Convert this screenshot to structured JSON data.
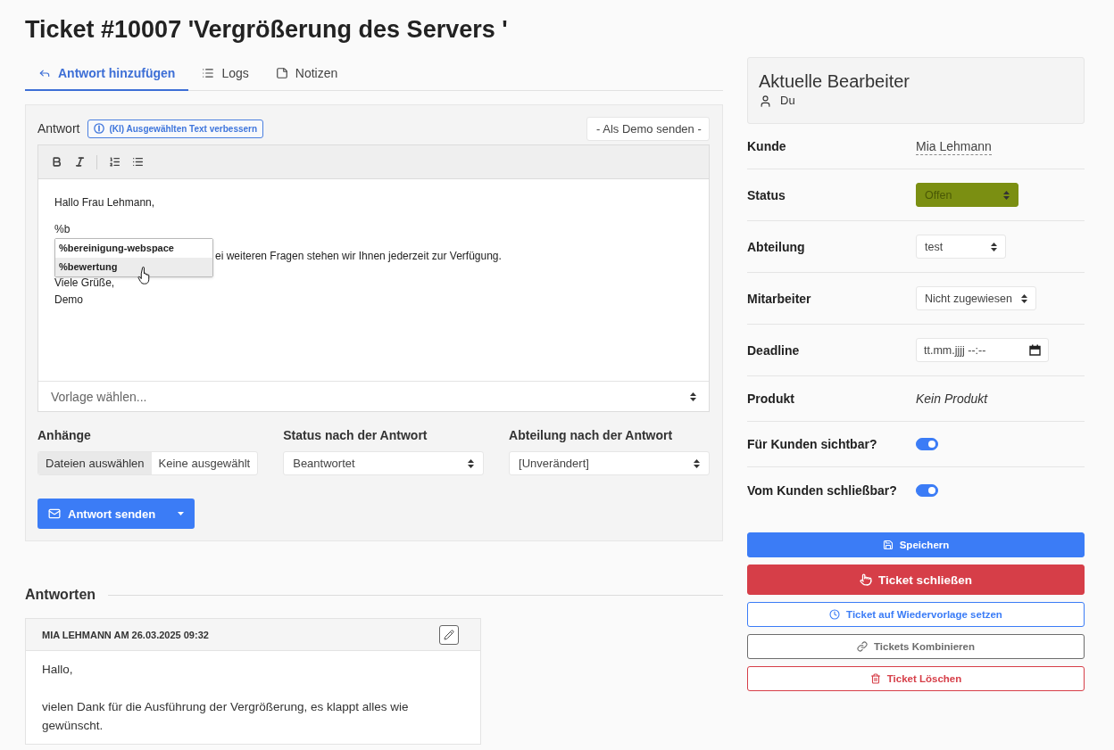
{
  "title": "Ticket #10007 'Vergrößerung des Servers '",
  "tabs": [
    {
      "label": "Antwort hinzufügen",
      "selected": true
    },
    {
      "label": "Logs",
      "selected": false
    },
    {
      "label": "Notizen",
      "selected": false
    }
  ],
  "reply_form": {
    "label": "Antwort",
    "ai_button": "(KI) Ausgewählten Text verbessern",
    "send_as_select": "- Als Demo senden -",
    "editor": {
      "paragraphs": [
        {
          "lines": [
            "Hallo Frau Lehmann,"
          ]
        },
        {
          "lines": [
            "%b"
          ],
          "suggestions": [
            {
              "label": "%bereinigung-webspace",
              "selected": false
            },
            {
              "label": "%bewertung",
              "selected": true
            }
          ]
        },
        {
          "lines": [
            "ei weiteren Fragen stehen wir Ihnen jederzeit zur Verfügung."
          ]
        },
        {
          "lines": [
            "Viele Grüße,",
            "Demo"
          ]
        }
      ],
      "template_select": "Vorlage wählen..."
    },
    "attachments": {
      "label": "Anhänge",
      "button": "Dateien auswählen",
      "value": "Keine ausgewählt"
    },
    "status_after": {
      "label": "Status nach der Antwort",
      "value": "Beantwortet"
    },
    "department_after": {
      "label": "Abteilung nach der Antwort",
      "value": "[Unverändert]"
    },
    "send_button": "Antwort senden"
  },
  "answers": {
    "title": "Antworten",
    "items": [
      {
        "header": "MIA LEHMANN AM 26.03.2025 09:32",
        "paragraphs": [
          "Hallo,",
          "vielen Dank für die Ausführung der Vergrößerung, es klappt alles wie gewünscht."
        ]
      }
    ]
  },
  "assignees": {
    "title": "Aktuelle Bearbeiter",
    "users": [
      "Du"
    ]
  },
  "properties": [
    {
      "kind": "link",
      "label": "Kunde",
      "value": "Mia Lehmann"
    },
    {
      "kind": "select",
      "label": "Status",
      "value": "Offen",
      "color": "#7b8f12"
    },
    {
      "kind": "select",
      "label": "Abteilung",
      "value": "test"
    },
    {
      "kind": "select",
      "label": "Mitarbeiter",
      "value": "Nicht zugewiesen"
    },
    {
      "kind": "date",
      "label": "Deadline",
      "placeholder": "tt.mm.jjjj --:--"
    },
    {
      "kind": "note",
      "label": "Produkt",
      "value": "Kein Produkt"
    },
    {
      "kind": "toggle",
      "label": "Für Kunden sichtbar?",
      "on": true
    },
    {
      "kind": "toggle",
      "label": "Vom Kunden schließbar?",
      "on": true
    }
  ],
  "actions": [
    {
      "kind": "primary",
      "label": "Speichern"
    },
    {
      "kind": "danger",
      "label": "Ticket schließen"
    },
    {
      "kind": "outline-primary",
      "label": "Ticket auf Wiedervorlage setzen"
    },
    {
      "kind": "outline-secondary",
      "label": "Tickets Kombinieren"
    },
    {
      "kind": "outline-danger",
      "label": "Ticket Löschen"
    }
  ]
}
